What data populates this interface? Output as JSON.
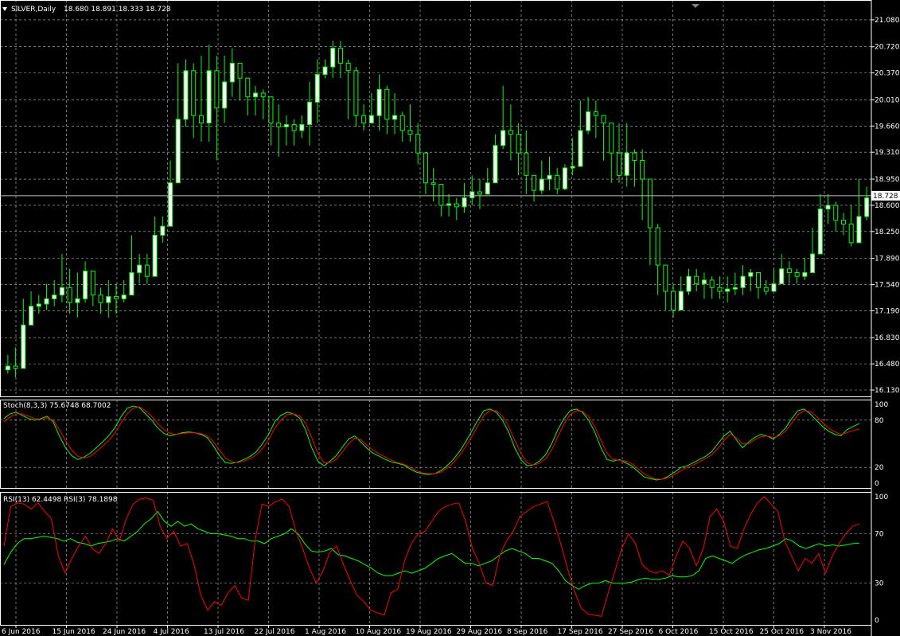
{
  "window": {
    "title_arrow_icon": "triangle-down-icon",
    "symbol_label": "SILVER,Daily",
    "ohlc_text": "18.680 18.891 18.333 18.728",
    "current_price_label": "18.728"
  },
  "colors": {
    "background": "#000000",
    "grid": "#c0c0c0",
    "axis": "#ffffff",
    "candle_bull": "#ffffff",
    "candle_bear": "#000000",
    "candle_outline": "#00ff00",
    "stoch_main": "#00ff00",
    "stoch_signal": "#ff0000",
    "rsi13": "#00ff00",
    "rsi3": "#ff0000"
  },
  "indicators": {
    "stoch_label": "Stoch(8,3,3) 75.6748 68.7002",
    "rsi_label": "RSI(13) 62.4498  RSI(3) 78.1898"
  },
  "chart_data": [
    {
      "type": "candlestick",
      "title": "SILVER,Daily",
      "ylim": [
        16.13,
        21.26
      ],
      "price_ticks": [
        "21.080",
        "20.720",
        "20.370",
        "20.010",
        "19.660",
        "19.310",
        "18.950",
        "18.600",
        "18.250",
        "17.890",
        "17.540",
        "17.190",
        "16.830",
        "16.480",
        "16.130"
      ],
      "current_price": 18.728,
      "x_tick_labels": [
        "6 Jun 2016",
        "15 Jun 2016",
        "24 Jun 2016",
        "4 Jul 2016",
        "13 Jul 2016",
        "22 Jul 2016",
        "1 Aug 2016",
        "10 Aug 2016",
        "19 Aug 2016",
        "29 Aug 2016",
        "8 Sep 2016",
        "17 Sep 2016",
        "27 Sep 2016",
        "6 Oct 2016",
        "15 Oct 2016",
        "25 Oct 2016",
        "3 Nov 2016"
      ],
      "close": [
        16.45,
        16.42,
        17.0,
        17.25,
        17.28,
        17.35,
        17.4,
        17.5,
        17.3,
        17.35,
        17.72,
        17.4,
        17.3,
        17.38,
        17.35,
        17.4,
        17.7,
        17.8,
        17.65,
        18.2,
        18.32,
        18.9,
        19.75,
        20.4,
        19.8,
        19.7,
        20.4,
        19.9,
        20.25,
        20.5,
        20.3,
        20.05,
        20.1,
        20.05,
        19.7,
        19.65,
        19.68,
        19.6,
        19.68,
        19.98,
        20.35,
        20.45,
        20.7,
        20.5,
        20.4,
        19.8,
        19.7,
        19.8,
        20.15,
        19.75,
        19.8,
        19.6,
        19.55,
        19.3,
        18.9,
        18.88,
        18.6,
        18.62,
        18.58,
        18.7,
        18.78,
        18.75,
        18.9,
        19.4,
        19.6,
        19.55,
        19.3,
        19.0,
        18.8,
        18.95,
        19.0,
        18.82,
        19.1,
        19.12,
        19.6,
        19.85,
        19.8,
        19.7,
        19.3,
        19.0,
        19.3,
        19.2,
        18.95,
        18.3,
        17.8,
        17.45,
        17.2,
        17.45,
        17.65,
        17.55,
        17.6,
        17.5,
        17.45,
        17.48,
        17.5,
        17.65,
        17.7,
        17.5,
        17.45,
        17.55,
        17.75,
        17.7,
        17.65,
        17.7,
        17.95,
        18.55,
        18.6,
        18.4,
        18.35,
        18.1,
        18.45,
        18.7
      ],
      "high": [
        16.6,
        16.7,
        17.35,
        17.45,
        17.4,
        17.55,
        17.6,
        17.95,
        17.75,
        17.7,
        17.85,
        17.7,
        17.5,
        17.6,
        17.55,
        17.6,
        18.2,
        17.95,
        17.95,
        18.45,
        18.45,
        19.2,
        20.5,
        20.55,
        20.5,
        20.6,
        20.75,
        20.6,
        20.6,
        20.7,
        20.4,
        20.25,
        20.2,
        20.15,
        19.95,
        19.95,
        19.8,
        19.75,
        19.8,
        20.25,
        20.55,
        20.55,
        20.8,
        20.8,
        20.55,
        20.45,
        19.95,
        20.1,
        20.35,
        20.2,
        20.1,
        19.85,
        19.95,
        19.7,
        19.05,
        19.1,
        18.85,
        18.75,
        18.7,
        18.9,
        19.0,
        18.95,
        19.1,
        19.55,
        20.2,
        19.95,
        19.7,
        19.6,
        18.95,
        19.2,
        19.25,
        19.1,
        19.15,
        19.5,
        20.0,
        20.05,
        20.0,
        19.8,
        19.55,
        19.7,
        19.7,
        19.35,
        19.35,
        18.95,
        18.35,
        17.8,
        17.55,
        17.65,
        17.75,
        17.75,
        17.7,
        17.65,
        17.65,
        17.65,
        17.7,
        17.8,
        17.75,
        17.65,
        17.6,
        17.75,
        17.95,
        17.85,
        17.75,
        17.9,
        18.3,
        18.75,
        18.75,
        18.65,
        18.5,
        18.6,
        18.95,
        18.85
      ],
      "low": [
        16.35,
        16.3,
        16.7,
        17.15,
        17.15,
        17.2,
        17.25,
        17.3,
        17.15,
        17.1,
        17.3,
        17.25,
        17.15,
        17.1,
        17.15,
        17.3,
        17.55,
        17.55,
        17.55,
        17.8,
        18.1,
        18.35,
        19.4,
        19.65,
        19.5,
        19.45,
        19.45,
        19.2,
        19.7,
        20.05,
        20.0,
        19.8,
        19.8,
        19.75,
        19.4,
        19.25,
        19.4,
        19.4,
        19.5,
        19.4,
        19.7,
        20.3,
        20.3,
        20.3,
        19.75,
        19.65,
        19.6,
        19.7,
        19.6,
        19.55,
        19.55,
        19.45,
        19.45,
        19.15,
        18.75,
        18.65,
        18.45,
        18.45,
        18.4,
        18.5,
        18.6,
        18.55,
        18.75,
        19.05,
        19.35,
        19.2,
        19.0,
        18.75,
        18.65,
        18.75,
        18.8,
        18.75,
        18.8,
        19.0,
        19.3,
        19.55,
        19.5,
        19.2,
        18.9,
        18.9,
        18.85,
        18.85,
        18.4,
        17.8,
        17.4,
        17.2,
        17.1,
        17.2,
        17.4,
        17.45,
        17.35,
        17.35,
        17.35,
        17.3,
        17.4,
        17.4,
        17.45,
        17.35,
        17.4,
        17.45,
        17.55,
        17.55,
        17.55,
        17.6,
        17.7,
        18.25,
        18.35,
        18.25,
        18.2,
        18.05,
        18.35,
        18.4
      ]
    },
    {
      "type": "line",
      "title": "Stoch(8,3,3) 75.6748 68.7002",
      "ylim": [
        0,
        100
      ],
      "y_ticks": [
        "100",
        "80",
        "20",
        "0"
      ],
      "series": [
        {
          "name": "Stoch(8,3,3) 75.6748",
          "values": [
            82,
            88,
            90,
            86,
            82,
            80,
            82,
            85,
            78,
            60,
            45,
            35,
            30,
            33,
            38,
            45,
            52,
            60,
            70,
            84,
            95,
            98,
            96,
            88,
            80,
            70,
            63,
            60,
            62,
            64,
            65,
            64,
            62,
            58,
            48,
            35,
            26,
            25,
            27,
            30,
            34,
            40,
            50,
            62,
            78,
            86,
            90,
            88,
            83,
            68,
            45,
            28,
            22,
            28,
            35,
            46,
            56,
            60,
            52,
            44,
            38,
            34,
            30,
            27,
            25,
            23,
            18,
            14,
            12,
            11,
            12,
            16,
            22,
            30,
            40,
            52,
            66,
            80,
            92,
            94,
            90,
            80,
            65,
            45,
            30,
            22,
            23,
            28,
            36,
            50,
            68,
            82,
            92,
            94,
            90,
            80,
            65,
            45,
            30,
            28,
            30,
            26,
            22,
            15,
            8,
            6,
            4,
            5,
            9,
            14,
            20,
            22,
            26,
            30,
            34,
            40,
            50,
            60,
            66,
            55,
            45,
            52,
            58,
            62,
            60,
            56,
            62,
            70,
            82,
            92,
            94,
            88,
            80,
            72,
            66,
            62,
            60,
            68,
            72,
            75.67
          ]
        },
        {
          "name": "68.7002",
          "values": [
            78,
            84,
            88,
            88,
            85,
            82,
            81,
            83,
            80,
            68,
            54,
            42,
            34,
            32,
            34,
            40,
            47,
            54,
            63,
            76,
            88,
            95,
            97,
            92,
            85,
            76,
            68,
            63,
            62,
            63,
            64,
            64,
            63,
            60,
            53,
            42,
            32,
            27,
            26,
            28,
            31,
            36,
            44,
            55,
            70,
            80,
            87,
            88,
            86,
            76,
            58,
            38,
            26,
            26,
            30,
            40,
            50,
            57,
            55,
            48,
            42,
            37,
            33,
            29,
            26,
            24,
            20,
            16,
            13,
            12,
            12,
            14,
            19,
            26,
            35,
            46,
            59,
            73,
            86,
            92,
            92,
            85,
            72,
            54,
            38,
            26,
            23,
            25,
            31,
            42,
            59,
            75,
            87,
            92,
            91,
            85,
            72,
            54,
            38,
            30,
            29,
            28,
            25,
            19,
            12,
            8,
            5,
            5,
            7,
            11,
            16,
            20,
            23,
            27,
            31,
            36,
            44,
            54,
            62,
            58,
            50,
            50,
            55,
            59,
            60,
            58,
            60,
            66,
            76,
            87,
            92,
            91,
            85,
            77,
            70,
            65,
            62,
            64,
            67,
            68.7
          ]
        }
      ]
    },
    {
      "type": "line",
      "title": "RSI(13) 62.4498  RSI(3) 78.1898",
      "ylim": [
        0,
        100
      ],
      "y_ticks": [
        "100",
        "70",
        "30",
        "0"
      ],
      "series": [
        {
          "name": "RSI(13) 62.4498",
          "values": [
            45,
            55,
            62,
            66,
            66,
            67,
            68,
            67,
            66,
            64,
            66,
            63,
            62,
            60,
            62,
            63,
            64,
            66,
            64,
            68,
            72,
            78,
            82,
            88,
            80,
            76,
            80,
            76,
            78,
            74,
            72,
            70,
            70,
            69,
            68,
            66,
            66,
            64,
            64,
            62,
            66,
            68,
            70,
            74,
            70,
            62,
            56,
            55,
            56,
            58,
            53,
            52,
            50,
            48,
            45,
            42,
            38,
            36,
            36,
            38,
            40,
            38,
            40,
            42,
            46,
            50,
            52,
            54,
            50,
            46,
            46,
            44,
            46,
            48,
            52,
            56,
            58,
            56,
            54,
            50,
            50,
            48,
            46,
            40,
            32,
            28,
            25,
            28,
            30,
            30,
            32,
            30,
            30,
            30,
            31,
            33,
            34,
            33,
            33,
            34,
            36,
            35,
            35,
            36,
            40,
            50,
            52,
            50,
            48,
            46,
            50,
            53,
            55,
            57,
            58,
            60,
            62,
            66,
            64,
            60,
            58,
            60,
            62,
            60,
            61,
            60,
            61,
            62,
            62.45
          ]
        },
        {
          "name": "RSI(3) 78.1898",
          "values": [
            60,
            92,
            95,
            94,
            90,
            95,
            88,
            82,
            52,
            38,
            50,
            60,
            68,
            58,
            54,
            62,
            74,
            64,
            82,
            94,
            98,
            99,
            97,
            76,
            66,
            72,
            60,
            62,
            45,
            20,
            8,
            15,
            12,
            22,
            28,
            18,
            16,
            65,
            94,
            92,
            96,
            98,
            92,
            72,
            58,
            42,
            30,
            40,
            55,
            60,
            45,
            32,
            20,
            15,
            8,
            6,
            4,
            22,
            25,
            48,
            62,
            70,
            72,
            80,
            88,
            92,
            94,
            95,
            80,
            58,
            46,
            30,
            28,
            52,
            64,
            72,
            84,
            88,
            92,
            94,
            96,
            80,
            62,
            42,
            24,
            10,
            5,
            4,
            3,
            22,
            40,
            58,
            70,
            62,
            45,
            40,
            38,
            40,
            36,
            52,
            64,
            58,
            44,
            58,
            84,
            90,
            80,
            60,
            58,
            74,
            86,
            95,
            100,
            94,
            88,
            64,
            52,
            40,
            50,
            46,
            54,
            38,
            52,
            62,
            70,
            76,
            78.19
          ]
        }
      ]
    }
  ]
}
